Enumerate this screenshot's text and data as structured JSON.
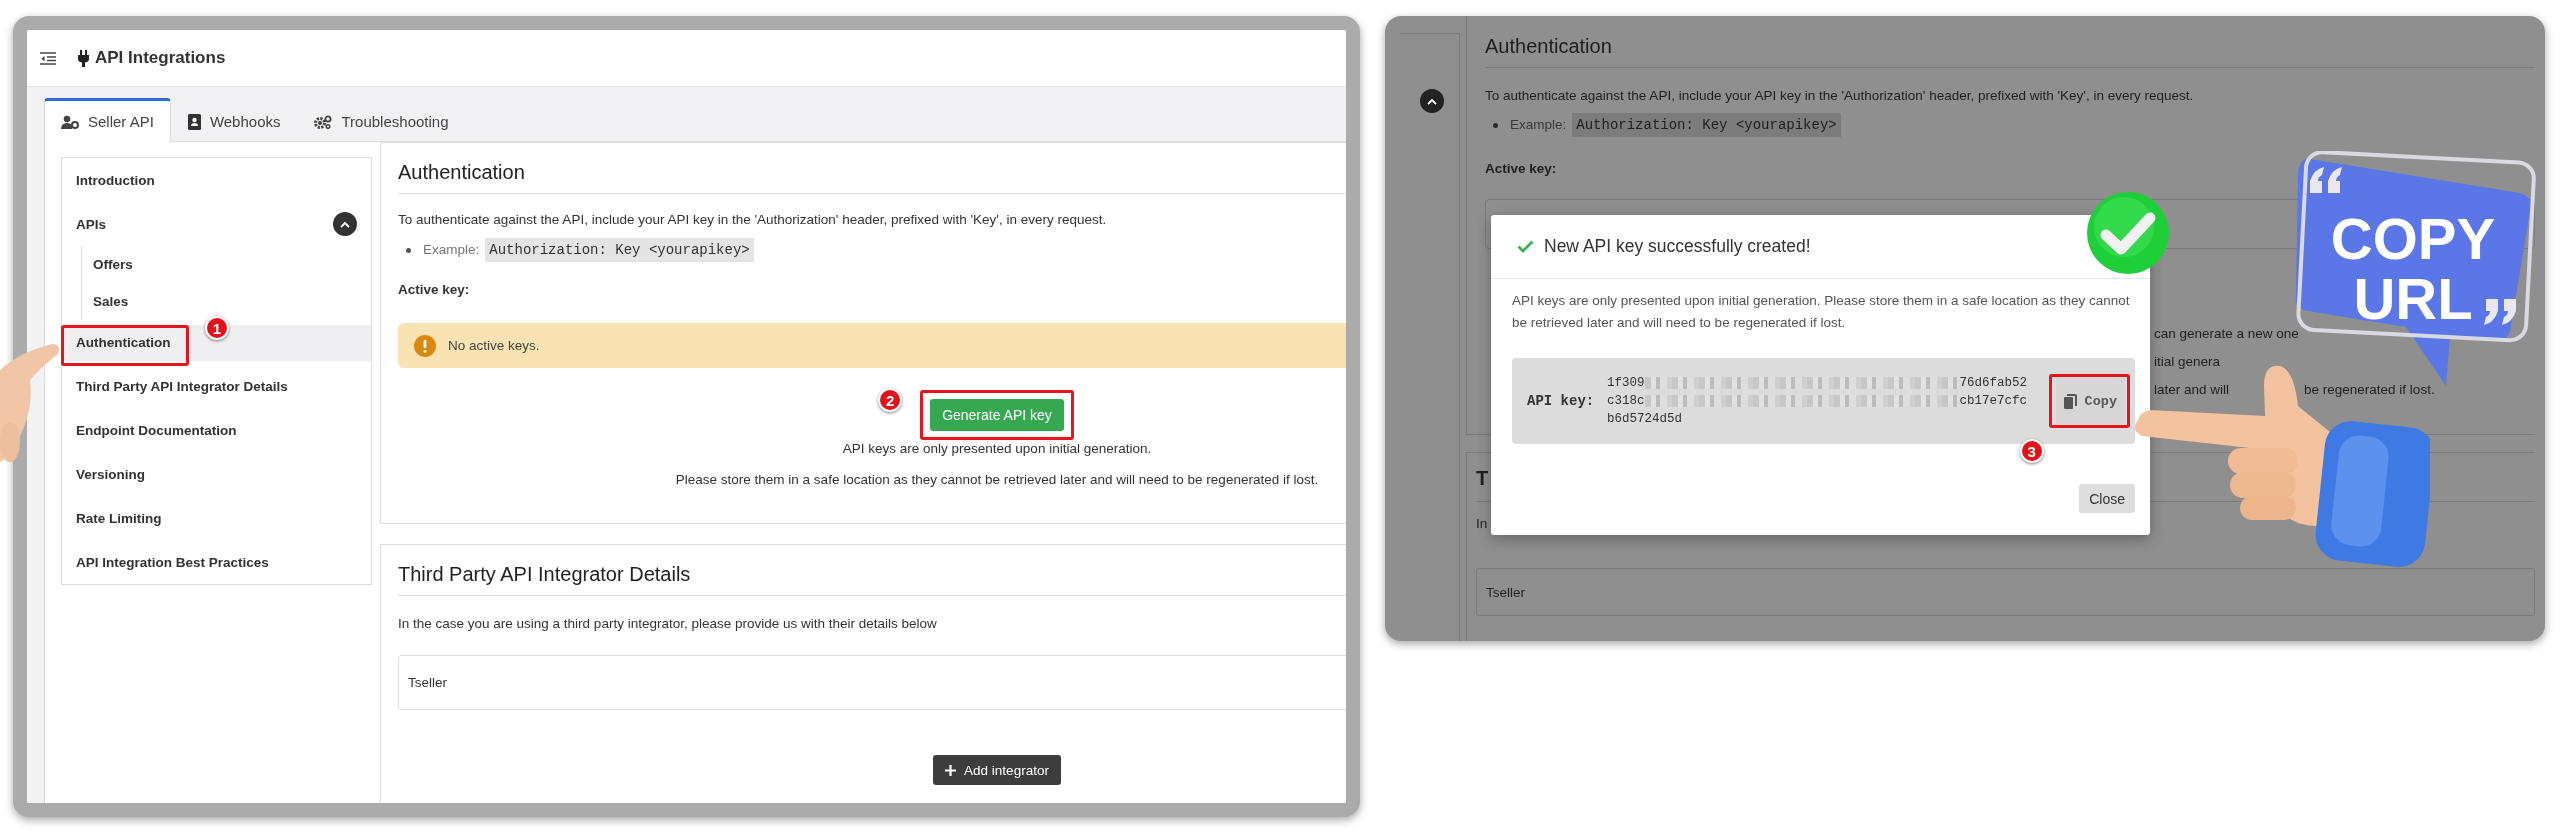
{
  "left_screen": {
    "header": {
      "title": "API Integrations"
    },
    "tabs": [
      {
        "label": "Seller API",
        "selected": true
      },
      {
        "label": "Webhooks",
        "selected": false
      },
      {
        "label": "Troubleshooting",
        "selected": false
      }
    ],
    "nav": [
      {
        "label": "Introduction",
        "selected": false
      },
      {
        "label": "APIs",
        "selected": false,
        "expanded": true,
        "children": [
          {
            "label": "Offers",
            "selected": false
          },
          {
            "label": "Sales",
            "selected": false
          }
        ]
      },
      {
        "label": "Authentication",
        "selected": true,
        "callout": "1"
      },
      {
        "label": "Third Party API Integrator Details",
        "selected": false
      },
      {
        "label": "Endpoint Documentation",
        "selected": false
      },
      {
        "label": "Versioning",
        "selected": false
      },
      {
        "label": "Rate Limiting",
        "selected": false
      },
      {
        "label": "API Integration Best Practices",
        "selected": false
      }
    ],
    "authentication": {
      "title": "Authentication",
      "description": "To authenticate against the API, include your API key in the 'Authorization' header, prefixed with 'Key', in every request.",
      "example_label": "Example:",
      "example_code": "Authorization: Key <yourapikey>",
      "active_key_label": "Active key:",
      "alert": "No active keys.",
      "button": {
        "label": "Generate API key",
        "callout": "2"
      },
      "notes": [
        "API keys are only presented upon initial generation.",
        "Please store them in a safe location as they cannot be retrieved later and will need to be regenerated if lost."
      ]
    },
    "integrator": {
      "title": "Third Party API Integrator Details",
      "description": "In the case you are using a third party integrator, please provide us with their details below",
      "entries": [
        "Tseller"
      ],
      "button": "Add integrator"
    }
  },
  "right_screen": {
    "nav_toggle": {
      "expanded": true
    },
    "authentication": {
      "title": "Authentication",
      "description": "To authenticate against the API, include your API key in the 'Authorization' header, prefixed with 'Key', in every request.",
      "example_label": "Example:",
      "example_code": "Authorization: Key <yourapikey>",
      "active_key_label": "Active key:",
      "partial_lines": [
        {
          "parts": [
            "can generate a new one"
          ]
        },
        {
          "parts": [
            "itial genera"
          ]
        },
        {
          "parts": [
            "later and will",
            "be regenerated if lost."
          ]
        }
      ]
    },
    "integrator": {
      "title": "T",
      "description": "In",
      "entries": [
        "Tseller"
      ]
    },
    "dialog": {
      "title": "New API key successfully created!",
      "message": "API keys are only presented upon initial generation. Please store them in a safe location as they cannot be retrieved later and will need to be regenerated if lost.",
      "key_label": "API key:",
      "key_lines": [
        {
          "start": "1f309",
          "end": "76d6fab52"
        },
        {
          "start": "c318c",
          "end": "cb17e7cfc"
        },
        {
          "start": "b6d5724d5d"
        }
      ],
      "copy_button": {
        "label": "Copy",
        "callout": "3"
      },
      "close_button": "Close"
    },
    "sticker": [
      "COPY",
      "URL"
    ]
  }
}
